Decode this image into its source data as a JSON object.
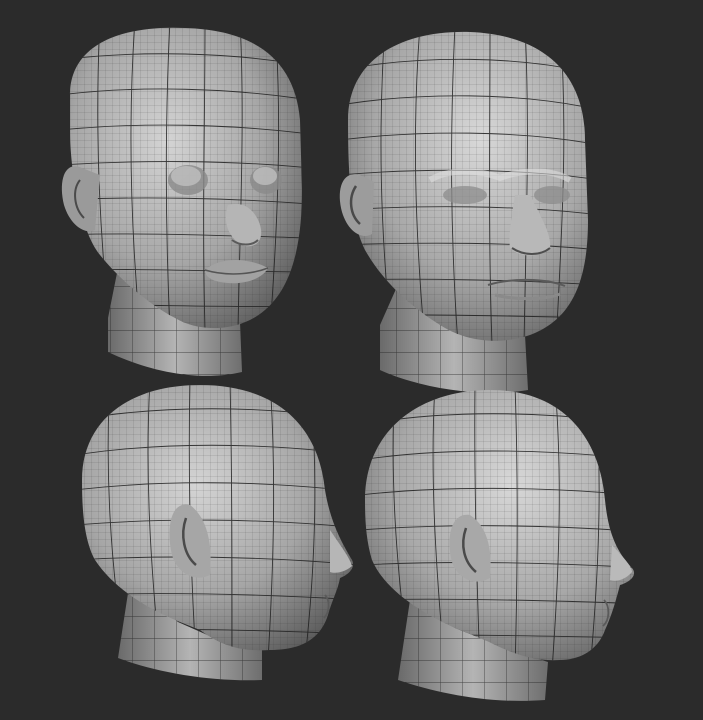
{
  "scene": {
    "background_color": "#2b2b2b",
    "mesh_light_color": "#d2d2d2",
    "mesh_mid_color": "#8e8e8e",
    "mesh_dark_color": "#4a4a4a",
    "wire_color": "#1e1e1e",
    "views": [
      {
        "name": "front-low-poly",
        "subject": "head-mesh-icon"
      },
      {
        "name": "front-high-poly",
        "subject": "head-mesh-icon"
      },
      {
        "name": "side-low-poly",
        "subject": "head-mesh-icon"
      },
      {
        "name": "side-high-poly",
        "subject": "head-mesh-icon"
      }
    ]
  }
}
